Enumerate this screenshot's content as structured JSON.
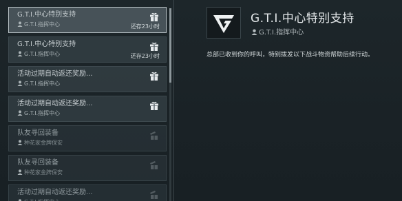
{
  "mail_list": [
    {
      "title": "G.T.I.中心特别支持",
      "sender": "G.T.I.指挥中心",
      "time_left": "还存23小时",
      "icon": "gift-icon",
      "selected": true,
      "read": false
    },
    {
      "title": "G.T.I.中心特别支持",
      "sender": "G.T.I.指挥中心",
      "time_left": "还存23小时",
      "icon": "gift-icon",
      "selected": false,
      "read": false
    },
    {
      "title": "活动过期自动返还奖励...",
      "sender": "G.T.I.指挥中心",
      "time_left": "",
      "icon": "gift-icon",
      "selected": false,
      "read": false
    },
    {
      "title": "活动过期自动返还奖励...",
      "sender": "G.T.I.指挥中心",
      "time_left": "",
      "icon": "gift-icon",
      "selected": false,
      "read": false
    },
    {
      "title": "队友寻回装备",
      "sender": "种花家金牌保安",
      "time_left": "",
      "icon": "gift-open-icon",
      "selected": false,
      "read": true
    },
    {
      "title": "队友寻回装备",
      "sender": "种花家金牌保安",
      "time_left": "",
      "icon": "gift-open-icon",
      "selected": false,
      "read": true
    },
    {
      "title": "活动过期自动返还奖励...",
      "sender": "G.T.I.指挥中心",
      "time_left": "",
      "icon": "gift-open-icon",
      "selected": false,
      "read": true
    }
  ],
  "detail": {
    "title": "G.T.I.中心特别支持",
    "sender": "G.T.I.指挥中心",
    "body": "总部已收到你的呼叫，特别拨发以下战斗物资帮助后续行动。"
  },
  "colors": {
    "accent_border": "#b9c2c6",
    "background": "#1b2327",
    "text": "#c9d0d3"
  }
}
